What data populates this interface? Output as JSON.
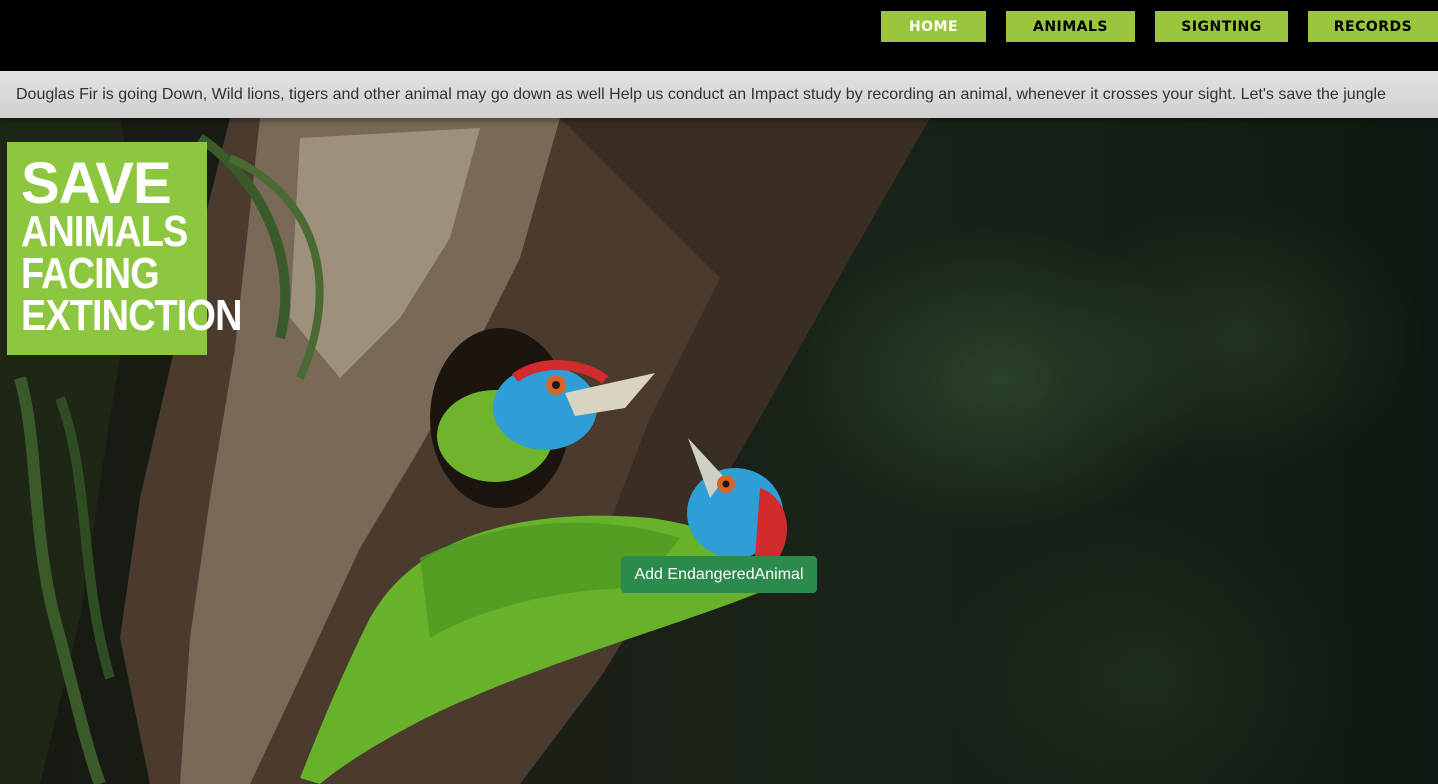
{
  "nav": {
    "home": "HOME",
    "animals": "ANIMALS",
    "sighting": "SIGNTING",
    "records": "RECORDS"
  },
  "banner": {
    "text": "Douglas Fir is going Down, Wild lions, tigers and other animal may go down as well Help us conduct an Impact study by recording an animal, whenever it crosses your sight. Let's save the jungle"
  },
  "badge": {
    "line1": "SAVE",
    "line2": "ANIMALS",
    "line3": "FACING",
    "line4": "EXTINCTION"
  },
  "actions": {
    "add_label": "Add EndangeredAnimal"
  },
  "colors": {
    "nav_bg": "#9bc53d",
    "badge_bg": "#8dc63f",
    "button_bg": "#2b8a4c"
  }
}
